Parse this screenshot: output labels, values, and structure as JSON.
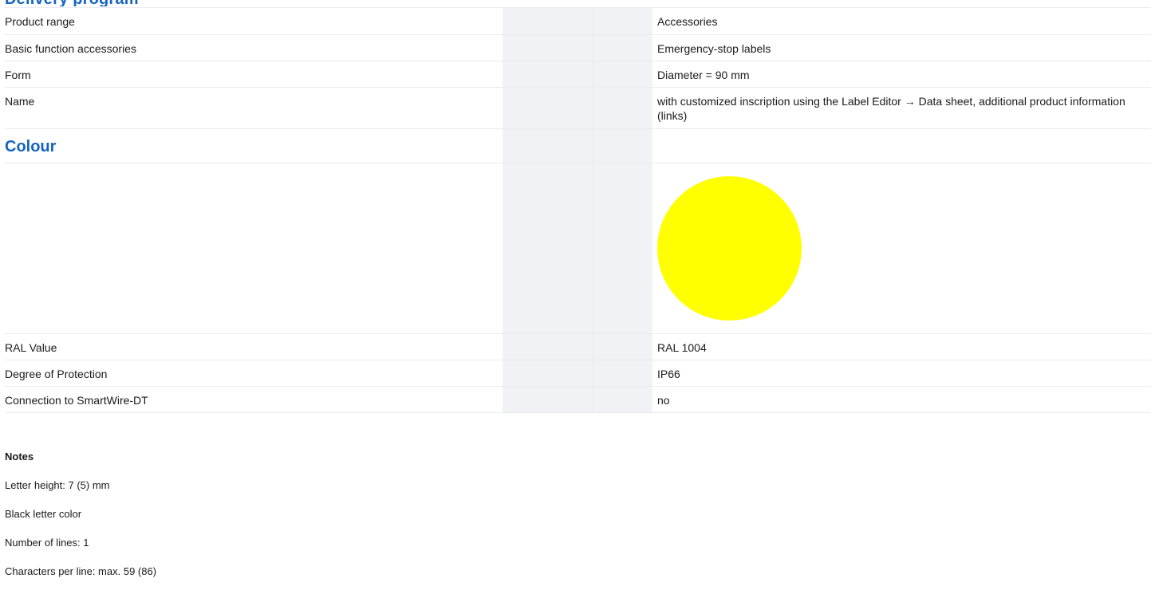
{
  "cut_heading": "Delivery program",
  "rows": {
    "product_range": {
      "label": "Product range",
      "value": "Accessories"
    },
    "basic_function": {
      "label": "Basic function accessories",
      "value": "Emergency-stop labels"
    },
    "form": {
      "label": "Form",
      "value": "Diameter = 90 mm"
    },
    "name": {
      "label": "Name",
      "value": "with customized inscription using the Label Editor → Data sheet, additional product information (links)"
    }
  },
  "colour": {
    "title": "Colour",
    "swatch_color": "#FFFF00",
    "ral_label": "RAL Value",
    "ral_value": "RAL 1004"
  },
  "rows2": {
    "protection": {
      "label": "Degree of Protection",
      "value": "IP66"
    },
    "smartwire": {
      "label": "Connection to SmartWire-DT",
      "value": "no"
    }
  },
  "notes": {
    "title": "Notes",
    "lines": [
      "Letter height: 7 (5) mm",
      "Black letter color",
      "Number of lines: 1",
      "Characters per line: max. 59 (86)"
    ]
  },
  "colors": {
    "accent": "#1565C0",
    "column_shade": "#F1F2F5",
    "row_rule": "#E9EBEE"
  }
}
